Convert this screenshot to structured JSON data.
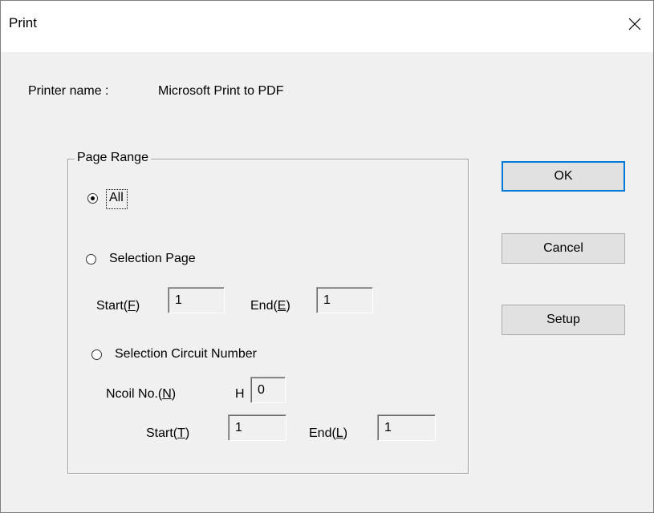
{
  "window": {
    "title": "Print"
  },
  "printer": {
    "label": "Printer name :",
    "value": "Microsoft Print to PDF"
  },
  "page_range": {
    "title": "Page Range",
    "selected": "all",
    "all": {
      "label": "All"
    },
    "selection_page": {
      "label": "Selection Page",
      "start_label_pre": "Start(",
      "start_key": "F",
      "start_value": "1",
      "end_label_pre": "End(",
      "end_key": "E",
      "end_value": "1"
    },
    "selection_circuit": {
      "label": "Selection Circuit Number",
      "ncoil_label_pre": "Ncoil No.(",
      "ncoil_key": "N",
      "h_label": "H",
      "h_value": "0",
      "start_label_pre": "Start(",
      "start_key": "T",
      "start_value": "1",
      "end_label_pre": "End(",
      "end_key": "L",
      "end_value": "1"
    },
    "paren_close": ")"
  },
  "buttons": {
    "ok": "OK",
    "cancel": "Cancel",
    "setup": "Setup"
  }
}
